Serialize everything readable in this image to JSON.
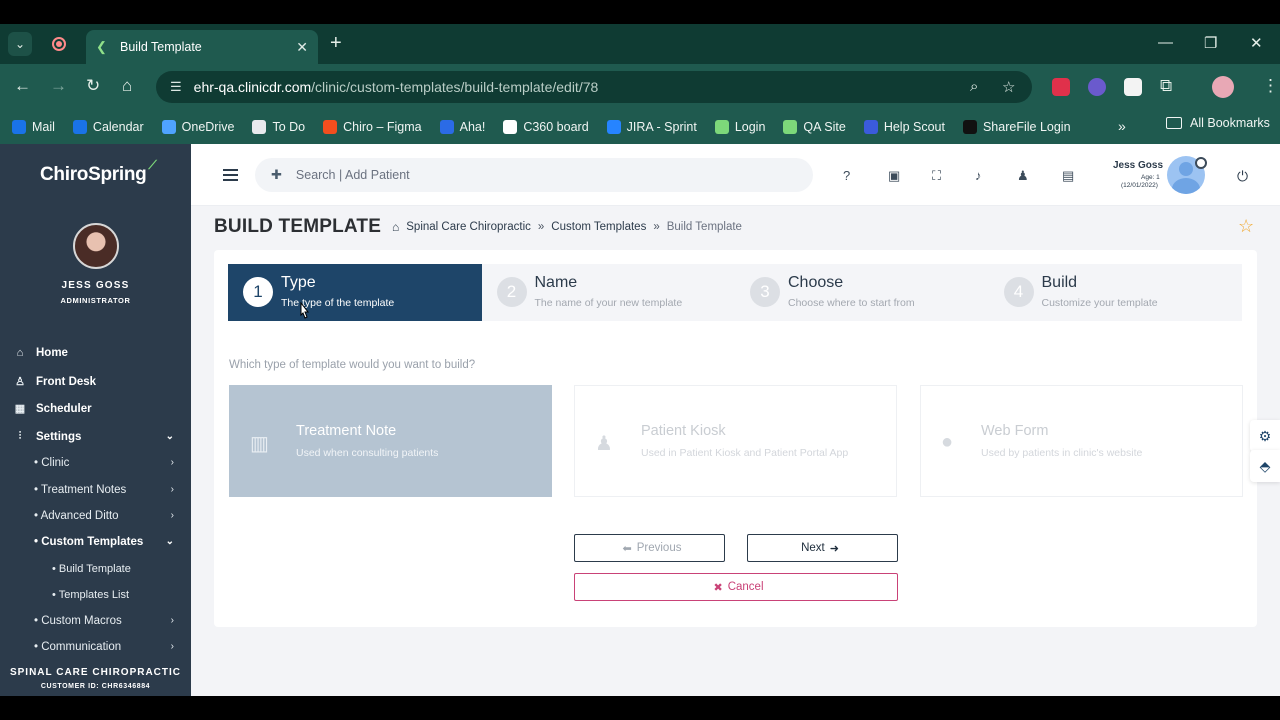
{
  "browser": {
    "tab_title": "Build Template",
    "url_host": "ehr-qa.clinicdr.com",
    "url_path": "/clinic/custom-templates/build-template/edit/78",
    "bookmarks": [
      {
        "label": "Mail",
        "color": "#1a73e8"
      },
      {
        "label": "Calendar",
        "color": "#1a73e8"
      },
      {
        "label": "OneDrive",
        "color": "#4fa3ff"
      },
      {
        "label": "To Do",
        "color": "#e8eaed"
      },
      {
        "label": "Chiro – Figma",
        "color": "#f24e1e"
      },
      {
        "label": "Aha!",
        "color": "#2b6be6"
      },
      {
        "label": "C360 board",
        "color": "#ffffff"
      },
      {
        "label": "JIRA - Sprint",
        "color": "#2684ff"
      },
      {
        "label": "Login",
        "color": "#7dd87a"
      },
      {
        "label": "QA Site",
        "color": "#7dd87a"
      },
      {
        "label": "Help Scout",
        "color": "#3b5bdb"
      },
      {
        "label": "ShareFile Login",
        "color": "#111111"
      }
    ],
    "all_bookmarks": "All Bookmarks"
  },
  "sidebar": {
    "logo": "ChiroSpring",
    "user_name": "JESS GOSS",
    "user_role": "ADMINISTRATOR",
    "nav": [
      {
        "label": "Home",
        "icon": "home-icon"
      },
      {
        "label": "Front Desk",
        "icon": "user-icon"
      },
      {
        "label": "Scheduler",
        "icon": "calendar-icon"
      },
      {
        "label": "Settings",
        "icon": "sliders-icon"
      }
    ],
    "settings_sub": [
      {
        "label": "• Clinic"
      },
      {
        "label": "• Treatment Notes"
      },
      {
        "label": "• Advanced Ditto"
      },
      {
        "label": "• Custom Templates"
      },
      {
        "label": "• Custom Macros"
      },
      {
        "label": "• Communication"
      }
    ],
    "custom_templates_sub": [
      {
        "label": "• Build Template"
      },
      {
        "label": "• Templates List"
      }
    ],
    "clinic_name": "SPINAL CARE CHIROPRACTIC",
    "customer_id": "CUSTOMER ID: CHR6346884"
  },
  "topbar": {
    "search_placeholder": "Search | Add Patient",
    "user_name": "Jess Goss",
    "user_age": "Age: 1",
    "user_dob": "(12/01/2022)"
  },
  "page": {
    "title": "BUILD TEMPLATE",
    "breadcrumbs": [
      "Spinal Care Chiropractic",
      "Custom Templates",
      "Build Template"
    ],
    "separator": "»"
  },
  "wizard": {
    "steps": [
      {
        "num": "1",
        "title": "Type",
        "desc": "The type of the template"
      },
      {
        "num": "2",
        "title": "Name",
        "desc": "The name of your new template"
      },
      {
        "num": "3",
        "title": "Choose",
        "desc": "Choose where to start from"
      },
      {
        "num": "4",
        "title": "Build",
        "desc": "Customize your template"
      }
    ],
    "question": "Which type of template would you want to build?",
    "options": [
      {
        "title": "Treatment Note",
        "desc": "Used when consulting patients",
        "icon": "clinic-medical-icon",
        "selected": true
      },
      {
        "title": "Patient Kiosk",
        "desc": "Used in Patient Kiosk and Patient Portal App",
        "icon": "user-plus-icon",
        "selected": false
      },
      {
        "title": "Web Form",
        "desc": "Used by patients in clinic's website",
        "icon": "globe-icon",
        "selected": false
      }
    ],
    "previous_label": "Previous",
    "next_label": "Next",
    "cancel_label": "Cancel"
  },
  "colors": {
    "sidebar_bg": "#2c3b4b",
    "active_step": "#1e4569",
    "selected_option": "#b5c4d2",
    "cancel": "#c94277",
    "browser_chrome": "#1f5a4f"
  }
}
